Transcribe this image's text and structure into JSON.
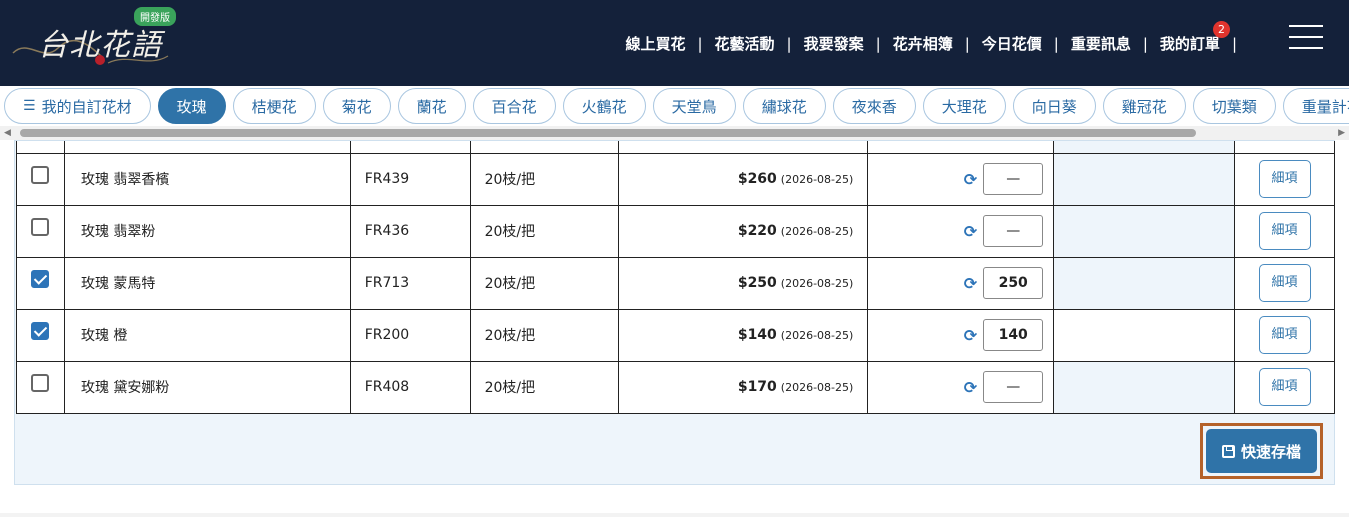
{
  "header": {
    "logo_text": "台北花語",
    "dev_badge": "開發版",
    "nav": [
      {
        "label": "線上買花"
      },
      {
        "label": "花藝活動"
      },
      {
        "label": "我要發案"
      },
      {
        "label": "花卉相簿"
      },
      {
        "label": "今日花價"
      },
      {
        "label": "重要訊息"
      },
      {
        "label": "我的訂單",
        "badge": "2"
      }
    ]
  },
  "categories": [
    {
      "label": "我的自訂花材",
      "icon": "list-icon"
    },
    {
      "label": "玫瑰",
      "active": true
    },
    {
      "label": "桔梗花"
    },
    {
      "label": "菊花"
    },
    {
      "label": "蘭花"
    },
    {
      "label": "百合花"
    },
    {
      "label": "火鶴花"
    },
    {
      "label": "天堂鳥"
    },
    {
      "label": "繡球花"
    },
    {
      "label": "夜來香"
    },
    {
      "label": "大理花"
    },
    {
      "label": "向日葵"
    },
    {
      "label": "雞冠花"
    },
    {
      "label": "切葉類"
    },
    {
      "label": "重量計花"
    }
  ],
  "table": {
    "rows": [
      {
        "checked": false,
        "name": "玫瑰 翡翠香檳",
        "code": "FR439",
        "unit": "20枝/把",
        "price": "$260",
        "date": "(2026-08-25)",
        "qty": "—",
        "highlight": true,
        "detail": "細項"
      },
      {
        "checked": false,
        "name": "玫瑰 翡翠粉",
        "code": "FR436",
        "unit": "20枝/把",
        "price": "$220",
        "date": "(2026-08-25)",
        "qty": "—",
        "highlight": true,
        "detail": "細項"
      },
      {
        "checked": true,
        "name": "玫瑰 蒙馬特",
        "code": "FR713",
        "unit": "20枝/把",
        "price": "$250",
        "date": "(2026-08-25)",
        "qty": "250",
        "highlight": true,
        "detail": "細項"
      },
      {
        "checked": true,
        "name": "玫瑰 橙",
        "code": "FR200",
        "unit": "20枝/把",
        "price": "$140",
        "date": "(2026-08-25)",
        "qty": "140",
        "highlight": false,
        "detail": "細項"
      },
      {
        "checked": false,
        "name": "玫瑰 黛安娜粉",
        "code": "FR408",
        "unit": "20枝/把",
        "price": "$170",
        "date": "(2026-08-25)",
        "qty": "—",
        "highlight": true,
        "detail": "細項"
      }
    ]
  },
  "save_button": {
    "label": "快速存檔"
  },
  "colors": {
    "header_bg": "#14213a",
    "accent": "#2f73a8",
    "badge": "#e0342d",
    "highlight_frame": "#b5622a"
  }
}
